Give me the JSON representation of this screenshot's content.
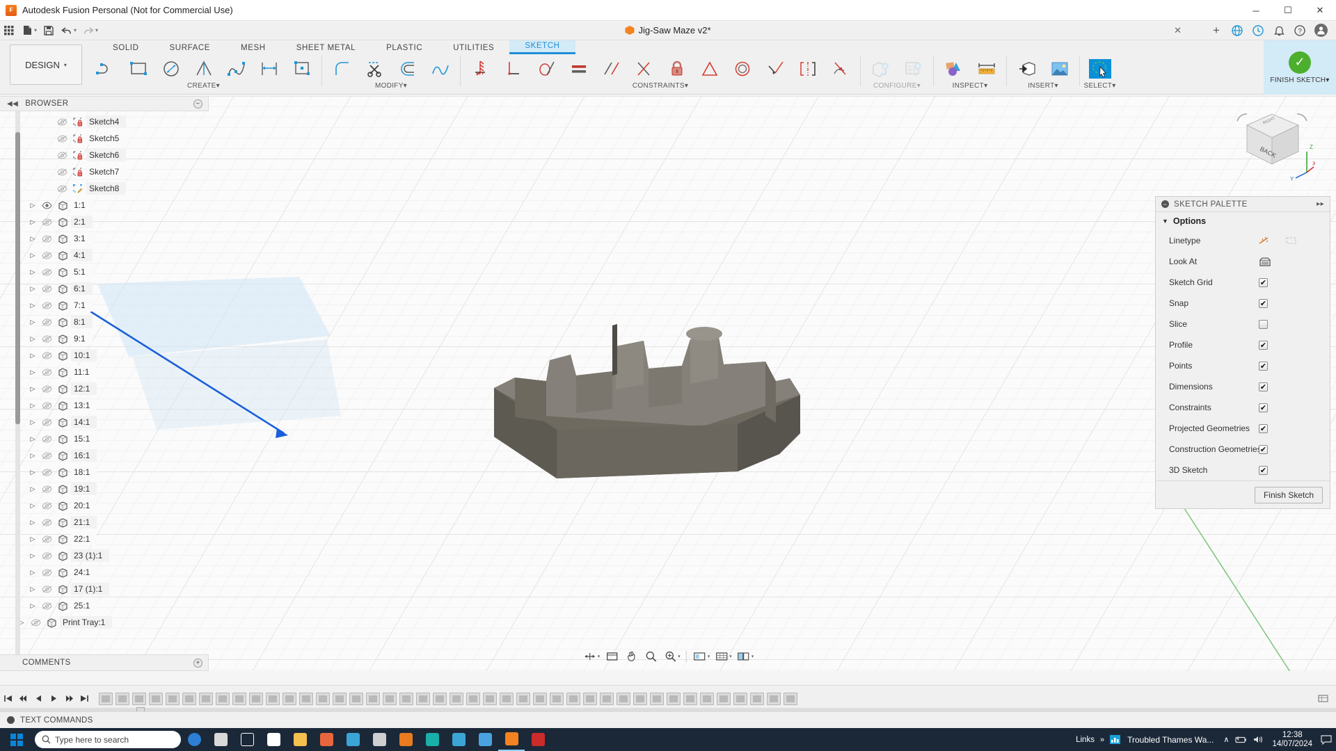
{
  "titlebar": {
    "app_title": "Autodesk Fusion Personal (Not for Commercial Use)",
    "app_icon": "fusion-logo-icon",
    "minimize": "─",
    "maximize": "☐",
    "close": "✕"
  },
  "qat": {
    "grid_icon": "app-grid-icon",
    "new_icon": "new-document-icon",
    "save_icon": "save-icon",
    "undo_icon": "undo-icon",
    "redo_icon": "redo-icon",
    "caret": "▾",
    "document_tab": "Jig-Saw Maze v2*",
    "tab_close": "✕",
    "add_tab": "+",
    "right_icons": [
      "globe-icon",
      "clock-icon",
      "bell-icon",
      "help-icon",
      "account-avatar"
    ]
  },
  "ribbon": {
    "design_label": "DESIGN",
    "design_caret": "▾",
    "tabs": [
      {
        "label": "SOLID",
        "active": false
      },
      {
        "label": "SURFACE",
        "active": false
      },
      {
        "label": "MESH",
        "active": false
      },
      {
        "label": "SHEET METAL",
        "active": false
      },
      {
        "label": "PLASTIC",
        "active": false
      },
      {
        "label": "UTILITIES",
        "active": false
      },
      {
        "label": "SKETCH",
        "active": true
      }
    ],
    "panels": [
      {
        "label": "CREATE",
        "caret": "▾",
        "tools": [
          "line-icon",
          "rectangle-icon",
          "circle-icon",
          "arc-icon",
          "spline-icon",
          "dimension-icon",
          "rectangular-pattern-icon"
        ]
      },
      {
        "label": "MODIFY",
        "caret": "▾",
        "tools": [
          "fillet-icon",
          "trim-icon",
          "offset-icon",
          "curvature-comb-icon"
        ]
      },
      {
        "label": "CONSTRAINTS",
        "caret": "▾",
        "tools": [
          "fix-ground-icon",
          "perpendicular-icon",
          "tangent-icon",
          "equal-icon",
          "parallel-icon",
          "horizontal-vertical-icon",
          "lock-constraint-icon",
          "coincident-icon",
          "concentric-icon",
          "collinear-icon",
          "symmetry-icon",
          "midpoint-icon"
        ]
      },
      {
        "label": "CONFIGURE",
        "caret": "▾",
        "tools": [
          "configure-part-icon",
          "configure-table-icon"
        ]
      },
      {
        "label": "INSPECT",
        "caret": "▾",
        "tools": [
          "interference-icon",
          "measure-icon"
        ]
      },
      {
        "label": "INSERT",
        "caret": "▾",
        "tools": [
          "insert-derive-icon",
          "insert-image-icon"
        ]
      },
      {
        "label": "SELECT",
        "caret": "▾",
        "tools": [
          "select-lasso-icon"
        ]
      }
    ],
    "finish": {
      "label": "FINISH SKETCH",
      "caret": "▾",
      "check": "✓"
    }
  },
  "browser": {
    "title": "BROWSER",
    "collapse_icon": "collapse-left-icon",
    "minimize_icon": "−",
    "eye_visible": "eye-visible-icon",
    "eye_hidden": "eye-hidden-icon",
    "arrow": "▷",
    "items": [
      {
        "label": "Sketch4",
        "type": "sketch",
        "visible": false,
        "locked": true,
        "arrow": false
      },
      {
        "label": "Sketch5",
        "type": "sketch",
        "visible": false,
        "locked": true,
        "arrow": false
      },
      {
        "label": "Sketch6",
        "type": "sketch",
        "visible": false,
        "locked": true,
        "arrow": false
      },
      {
        "label": "Sketch7",
        "type": "sketch",
        "visible": false,
        "locked": true,
        "arrow": false
      },
      {
        "label": "Sketch8",
        "type": "sketch",
        "visible": false,
        "locked": false,
        "arrow": false,
        "editing": true
      },
      {
        "label": "1:1",
        "type": "component",
        "visible": true,
        "arrow": true
      },
      {
        "label": "2:1",
        "type": "component",
        "visible": false,
        "arrow": true
      },
      {
        "label": "3:1",
        "type": "component",
        "visible": false,
        "arrow": true
      },
      {
        "label": "4:1",
        "type": "component",
        "visible": false,
        "arrow": true
      },
      {
        "label": "5:1",
        "type": "component",
        "visible": false,
        "arrow": true
      },
      {
        "label": "6:1",
        "type": "component",
        "visible": false,
        "arrow": true
      },
      {
        "label": "7:1",
        "type": "component",
        "visible": false,
        "arrow": true
      },
      {
        "label": "8:1",
        "type": "component",
        "visible": false,
        "arrow": true
      },
      {
        "label": "9:1",
        "type": "component",
        "visible": false,
        "arrow": true
      },
      {
        "label": "10:1",
        "type": "component",
        "visible": false,
        "arrow": true
      },
      {
        "label": "11:1",
        "type": "component",
        "visible": false,
        "arrow": true
      },
      {
        "label": "12:1",
        "type": "component",
        "visible": false,
        "arrow": true
      },
      {
        "label": "13:1",
        "type": "component",
        "visible": false,
        "arrow": true
      },
      {
        "label": "14:1",
        "type": "component",
        "visible": false,
        "arrow": true
      },
      {
        "label": "15:1",
        "type": "component",
        "visible": false,
        "arrow": true
      },
      {
        "label": "16:1",
        "type": "component",
        "visible": false,
        "arrow": true
      },
      {
        "label": "18:1",
        "type": "component",
        "visible": false,
        "arrow": true
      },
      {
        "label": "19:1",
        "type": "component",
        "visible": false,
        "arrow": true
      },
      {
        "label": "20:1",
        "type": "component",
        "visible": false,
        "arrow": true
      },
      {
        "label": "21:1",
        "type": "component",
        "visible": false,
        "arrow": true
      },
      {
        "label": "22:1",
        "type": "component",
        "visible": false,
        "arrow": true
      },
      {
        "label": "23 (1):1",
        "type": "component",
        "visible": false,
        "arrow": true
      },
      {
        "label": "24:1",
        "type": "component",
        "visible": false,
        "arrow": true
      },
      {
        "label": "17 (1):1",
        "type": "component",
        "visible": false,
        "arrow": true
      },
      {
        "label": "25:1",
        "type": "component",
        "visible": false,
        "arrow": true
      },
      {
        "label": "Print Tray:1",
        "type": "component",
        "visible": false,
        "arrow": true,
        "root": true
      }
    ]
  },
  "comments": {
    "title": "COMMENTS",
    "add_icon": "+"
  },
  "palette": {
    "title": "SKETCH PALETTE",
    "collapse_dot": "−",
    "expand_icon": "▸▸",
    "options_header": "Options",
    "options_caret": "▼",
    "rows": [
      {
        "label": "Linetype",
        "control": "icons",
        "icons": [
          "linetype-normal-icon",
          "linetype-construction-icon"
        ]
      },
      {
        "label": "Look At",
        "control": "icon",
        "icons": [
          "look-at-icon"
        ]
      },
      {
        "label": "Sketch Grid",
        "control": "checkbox",
        "checked": true
      },
      {
        "label": "Snap",
        "control": "checkbox",
        "checked": true
      },
      {
        "label": "Slice",
        "control": "checkbox",
        "checked": false
      },
      {
        "label": "Profile",
        "control": "checkbox",
        "checked": true
      },
      {
        "label": "Points",
        "control": "checkbox",
        "checked": true
      },
      {
        "label": "Dimensions",
        "control": "checkbox",
        "checked": true
      },
      {
        "label": "Constraints",
        "control": "checkbox",
        "checked": true
      },
      {
        "label": "Projected Geometries",
        "control": "checkbox",
        "checked": true
      },
      {
        "label": "Construction Geometries",
        "control": "checkbox",
        "checked": true
      },
      {
        "label": "3D Sketch",
        "control": "checkbox",
        "checked": true
      }
    ],
    "finish_button": "Finish Sketch",
    "check_glyph": "✔"
  },
  "viewcube": {
    "face_label": "BACK",
    "corner_label": "RIGHT",
    "axis_x": "X",
    "axis_y": "Y",
    "axis_z": "Z",
    "home_icon": "home-icon"
  },
  "navbar": {
    "items": [
      {
        "icon": "orbit-icon",
        "caret": true
      },
      {
        "icon": "fit-view-icon",
        "caret": false
      },
      {
        "icon": "pan-icon",
        "caret": false
      },
      {
        "icon": "zoom-icon",
        "caret": false
      },
      {
        "icon": "zoom-window-icon",
        "caret": true
      },
      {
        "icon": "display-settings-icon",
        "caret": true
      },
      {
        "icon": "grid-settings-icon",
        "caret": true
      },
      {
        "icon": "viewports-icon",
        "caret": true
      }
    ]
  },
  "timeline": {
    "controls": [
      "skip-start-icon",
      "step-back-icon",
      "play-back-icon",
      "play-icon",
      "step-forward-icon",
      "skip-end-icon"
    ],
    "node_count": 42,
    "right_controls": [
      "timeline-settings-icon"
    ],
    "marker": "timeline-marker"
  },
  "textcommands": {
    "title": "TEXT COMMANDS"
  },
  "taskbar": {
    "start_icon": "windows-start-icon",
    "search_placeholder": "Type here to search",
    "search_icon": "search-icon",
    "apps": [
      {
        "name": "cortana-icon",
        "color": "#2d7fd3"
      },
      {
        "name": "weather-icon",
        "color": "#d9d9d9"
      },
      {
        "name": "task-view-icon",
        "color": "#ffffff"
      },
      {
        "name": "mail-icon",
        "color": "#ffffff"
      },
      {
        "name": "file-explorer-icon",
        "color": "#f5c04e"
      },
      {
        "name": "media-player-icon",
        "color": "#e8663d"
      },
      {
        "name": "paint-icon",
        "color": "#3ba5d6"
      },
      {
        "name": "settings-icon",
        "color": "#cfcfcf"
      },
      {
        "name": "office-icon",
        "color": "#e87b20"
      },
      {
        "name": "camera-icon",
        "color": "#18b0a8"
      },
      {
        "name": "edge-icon",
        "color": "#3ba5d6"
      },
      {
        "name": "vpn-icon",
        "color": "#4aa3df"
      },
      {
        "name": "fusion-icon",
        "color": "#f58220"
      },
      {
        "name": "kaspersky-icon",
        "color": "#cc2b2b"
      }
    ],
    "links_label": "Links",
    "links_chevron": "»",
    "news_icon": "news-weather-icon",
    "news_label": "Troubled Thames Wa...",
    "tray_up": "∧",
    "tray_icons": [
      "battery-icon",
      "volume-icon"
    ],
    "time": "12:38",
    "date": "14/07/2024",
    "notification_icon": "notification-icon"
  }
}
